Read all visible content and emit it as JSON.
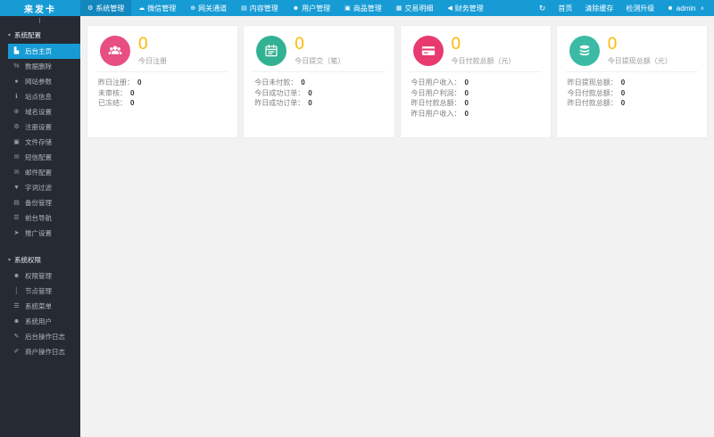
{
  "topbar": {
    "logo": "来发卡",
    "menu": [
      {
        "label": "系统管理",
        "icon": "gear-icon",
        "active": true
      },
      {
        "label": "微信管理",
        "icon": "wechat-icon",
        "active": false
      },
      {
        "label": "网关通道",
        "icon": "gateway-icon",
        "active": false
      },
      {
        "label": "内容管理",
        "icon": "content-icon",
        "active": false
      },
      {
        "label": "用户管理",
        "icon": "users-icon",
        "active": false
      },
      {
        "label": "商品管理",
        "icon": "goods-icon",
        "active": false
      },
      {
        "label": "交易明细",
        "icon": "chart-icon",
        "active": false
      },
      {
        "label": "财务管理",
        "icon": "finance-icon",
        "active": false
      }
    ],
    "right": {
      "home": "首页",
      "clear_cache": "清除缓存",
      "check_upgrade": "检测升级",
      "username": "admin"
    }
  },
  "sidebar": {
    "sections": [
      {
        "label": "系统配置",
        "items": [
          {
            "label": "后台主页",
            "active": true
          },
          {
            "label": "数据删除",
            "active": false
          },
          {
            "label": "网站参数",
            "active": false
          },
          {
            "label": "站点信息",
            "active": false
          },
          {
            "label": "域名设置",
            "active": false
          },
          {
            "label": "注册设置",
            "active": false
          },
          {
            "label": "文件存储",
            "active": false
          },
          {
            "label": "短信配置",
            "active": false
          },
          {
            "label": "邮件配置",
            "active": false
          },
          {
            "label": "字词过滤",
            "active": false
          },
          {
            "label": "备份管理",
            "active": false
          },
          {
            "label": "前台导航",
            "active": false
          },
          {
            "label": "推广设置",
            "active": false
          }
        ]
      },
      {
        "label": "系统权限",
        "items": [
          {
            "label": "权限管理",
            "active": false
          },
          {
            "label": "节点管理",
            "active": false
          },
          {
            "label": "系统菜单",
            "active": false
          },
          {
            "label": "系统用户",
            "active": false
          },
          {
            "label": "后台操作日志",
            "active": false
          },
          {
            "label": "商户操作日志",
            "active": false
          }
        ]
      }
    ]
  },
  "cards": [
    {
      "value": "0",
      "label": "今日注册",
      "icon": "group-users-icon",
      "color": "#e74e82",
      "stats": [
        {
          "label": "昨日注册：",
          "value": "0"
        },
        {
          "label": "未审核：",
          "value": "0"
        },
        {
          "label": "已冻结：",
          "value": "0"
        }
      ]
    },
    {
      "value": "0",
      "label": "今日提交（笔）",
      "icon": "calendar-icon",
      "color": "#33b293",
      "stats": [
        {
          "label": "今日未付款：",
          "value": "0"
        },
        {
          "label": "今日成功订单：",
          "value": "0"
        },
        {
          "label": "昨日成功订单：",
          "value": "0"
        }
      ]
    },
    {
      "value": "0",
      "label": "今日付款总额（元）",
      "icon": "credit-card-icon",
      "color": "#e73a6e",
      "stats": [
        {
          "label": "今日用户收入：",
          "value": "0"
        },
        {
          "label": "今日用户利润：",
          "value": "0"
        },
        {
          "label": "昨日付款总额：",
          "value": "0"
        },
        {
          "label": "昨日用户收入：",
          "value": "0"
        }
      ]
    },
    {
      "value": "0",
      "label": "今日提现总额（元）",
      "icon": "database-icon",
      "color": "#3bbba6",
      "stats": [
        {
          "label": "昨日提现总额：",
          "value": "0"
        },
        {
          "label": "今日付款总额：",
          "value": "0"
        },
        {
          "label": "昨日付款总额：",
          "value": "0"
        }
      ]
    }
  ],
  "icons": {
    "gear": "⚙",
    "wechat": "☁",
    "gateway": "⊕",
    "content": "▤",
    "users": "☻",
    "goods": "▣",
    "chart": "▦",
    "finance": "◀",
    "refresh": "↻",
    "user": "☻",
    "caret_up": "∧",
    "caret_down": "▾",
    "dashboard": "▙",
    "link": "%",
    "apple": "●",
    "info": "ℹ",
    "compass": "⊕",
    "gear2": "⚙",
    "save": "▣",
    "envelope": "✉",
    "envelope2": "✉",
    "filter": "▼",
    "backup": "▤",
    "list": "☰",
    "megaphone": "➤",
    "person": "☻",
    "pipe": "│",
    "menu": "☰",
    "group": "☻",
    "pencil": "✎",
    "pencil2": "✐"
  },
  "colors": {
    "topbar": "#169bd5",
    "topbar_active": "#1187bd",
    "sidebar_bg": "#262b33",
    "sidebar_active": "#169bd5",
    "main_bg": "#f2f2f2",
    "value_orange": "#ffb800",
    "card1_icon": "#e74e82",
    "card2_icon": "#33b293",
    "card3_icon": "#e73a6e",
    "card4_icon": "#3bbba6"
  }
}
